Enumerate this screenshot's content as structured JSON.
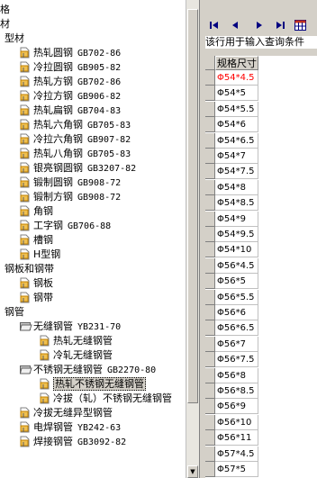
{
  "tree": {
    "rows": [
      {
        "label": "格",
        "code": "",
        "level": 0,
        "icon": "none"
      },
      {
        "label": "材",
        "code": "",
        "level": 0,
        "icon": "none"
      },
      {
        "label": "型材",
        "code": "",
        "level": 1,
        "icon": "none"
      },
      {
        "label": "热轧圆钢",
        "code": "GB702-86",
        "level": 2,
        "icon": "folder-icon"
      },
      {
        "label": "冷拉圆钢",
        "code": "GB905-82",
        "level": 2,
        "icon": "folder-icon"
      },
      {
        "label": "热轧方钢",
        "code": "GB702-86",
        "level": 2,
        "icon": "folder-icon"
      },
      {
        "label": "冷拉方钢",
        "code": "GB906-82",
        "level": 2,
        "icon": "folder-icon"
      },
      {
        "label": "热轧扁钢",
        "code": "GB704-83",
        "level": 2,
        "icon": "folder-icon"
      },
      {
        "label": "热轧六角钢",
        "code": "GB705-83",
        "level": 2,
        "icon": "folder-icon"
      },
      {
        "label": "冷拉六角钢",
        "code": "GB907-82",
        "level": 2,
        "icon": "folder-icon"
      },
      {
        "label": "热轧八角钢",
        "code": "GB705-83",
        "level": 2,
        "icon": "folder-icon"
      },
      {
        "label": "银亮钢圆钢",
        "code": "GB3207-82",
        "level": 2,
        "icon": "folder-icon"
      },
      {
        "label": "锻制圆钢",
        "code": "GB908-72",
        "level": 2,
        "icon": "folder-icon"
      },
      {
        "label": "锻制方钢",
        "code": "GB908-72",
        "level": 2,
        "icon": "folder-icon"
      },
      {
        "label": "角钢",
        "code": "",
        "level": 2,
        "icon": "folder-icon"
      },
      {
        "label": "工字钢",
        "code": "GB706-88",
        "level": 2,
        "icon": "folder-icon"
      },
      {
        "label": "槽钢",
        "code": "",
        "level": 2,
        "icon": "folder-icon"
      },
      {
        "label": "H型钢",
        "code": "",
        "level": 2,
        "icon": "folder-icon"
      },
      {
        "label": "钢板和钢带",
        "code": "",
        "level": 1,
        "icon": "none"
      },
      {
        "label": "钢板",
        "code": "",
        "level": 2,
        "icon": "folder-icon"
      },
      {
        "label": "钢带",
        "code": "",
        "level": 2,
        "icon": "folder-icon"
      },
      {
        "label": "钢管",
        "code": "",
        "level": 1,
        "icon": "none"
      },
      {
        "label": "无缝钢管",
        "code": "YB231-70",
        "level": 2,
        "icon": "open-folder-icon"
      },
      {
        "label": "热轧无缝钢管",
        "code": "",
        "level": 3,
        "icon": "folder-icon"
      },
      {
        "label": "冷轧无缝钢管",
        "code": "",
        "level": 3,
        "icon": "folder-icon"
      },
      {
        "label": "不锈钢无缝钢管",
        "code": "GB2270-80",
        "level": 2,
        "icon": "open-folder-icon"
      },
      {
        "label": "热轧不锈钢无缝钢管",
        "code": "",
        "level": 3,
        "icon": "folder-icon",
        "selected": true
      },
      {
        "label": "冷拔（轧）不锈钢无缝钢管",
        "code": "",
        "level": 3,
        "icon": "folder-icon"
      },
      {
        "label": "冷拔无缝异型钢管",
        "code": "",
        "level": 2,
        "icon": "folder-icon"
      },
      {
        "label": "电焊钢管",
        "code": "YB242-63",
        "level": 2,
        "icon": "folder-icon"
      },
      {
        "label": "焊接钢管",
        "code": "GB3092-82",
        "level": 2,
        "icon": "folder-icon"
      }
    ]
  },
  "nav": {
    "buttons": [
      "first-record-icon",
      "prior-record-icon",
      "next-record-icon",
      "last-record-icon",
      "grid-view-icon"
    ]
  },
  "hint": "该行用于输入查询条件",
  "grid": {
    "column_header": "规格尺寸",
    "rows": [
      "Φ54*4.5",
      "Φ54*5",
      "Φ54*5.5",
      "Φ54*6",
      "Φ54*6.5",
      "Φ54*7",
      "Φ54*7.5",
      "Φ54*8",
      "Φ54*8.5",
      "Φ54*9",
      "Φ54*9.5",
      "Φ54*10",
      "Φ56*4.5",
      "Φ56*5",
      "Φ56*5.5",
      "Φ56*6",
      "Φ56*6.5",
      "Φ56*7",
      "Φ56*7.5",
      "Φ56*8",
      "Φ56*8.5",
      "Φ56*9",
      "Φ56*10",
      "Φ56*11",
      "Φ57*4.5",
      "Φ57*5"
    ],
    "current_index": 0
  },
  "colors": {
    "accent": "#000080",
    "current_row_text": "#ff0000",
    "folder_fill": "#f0c050"
  }
}
